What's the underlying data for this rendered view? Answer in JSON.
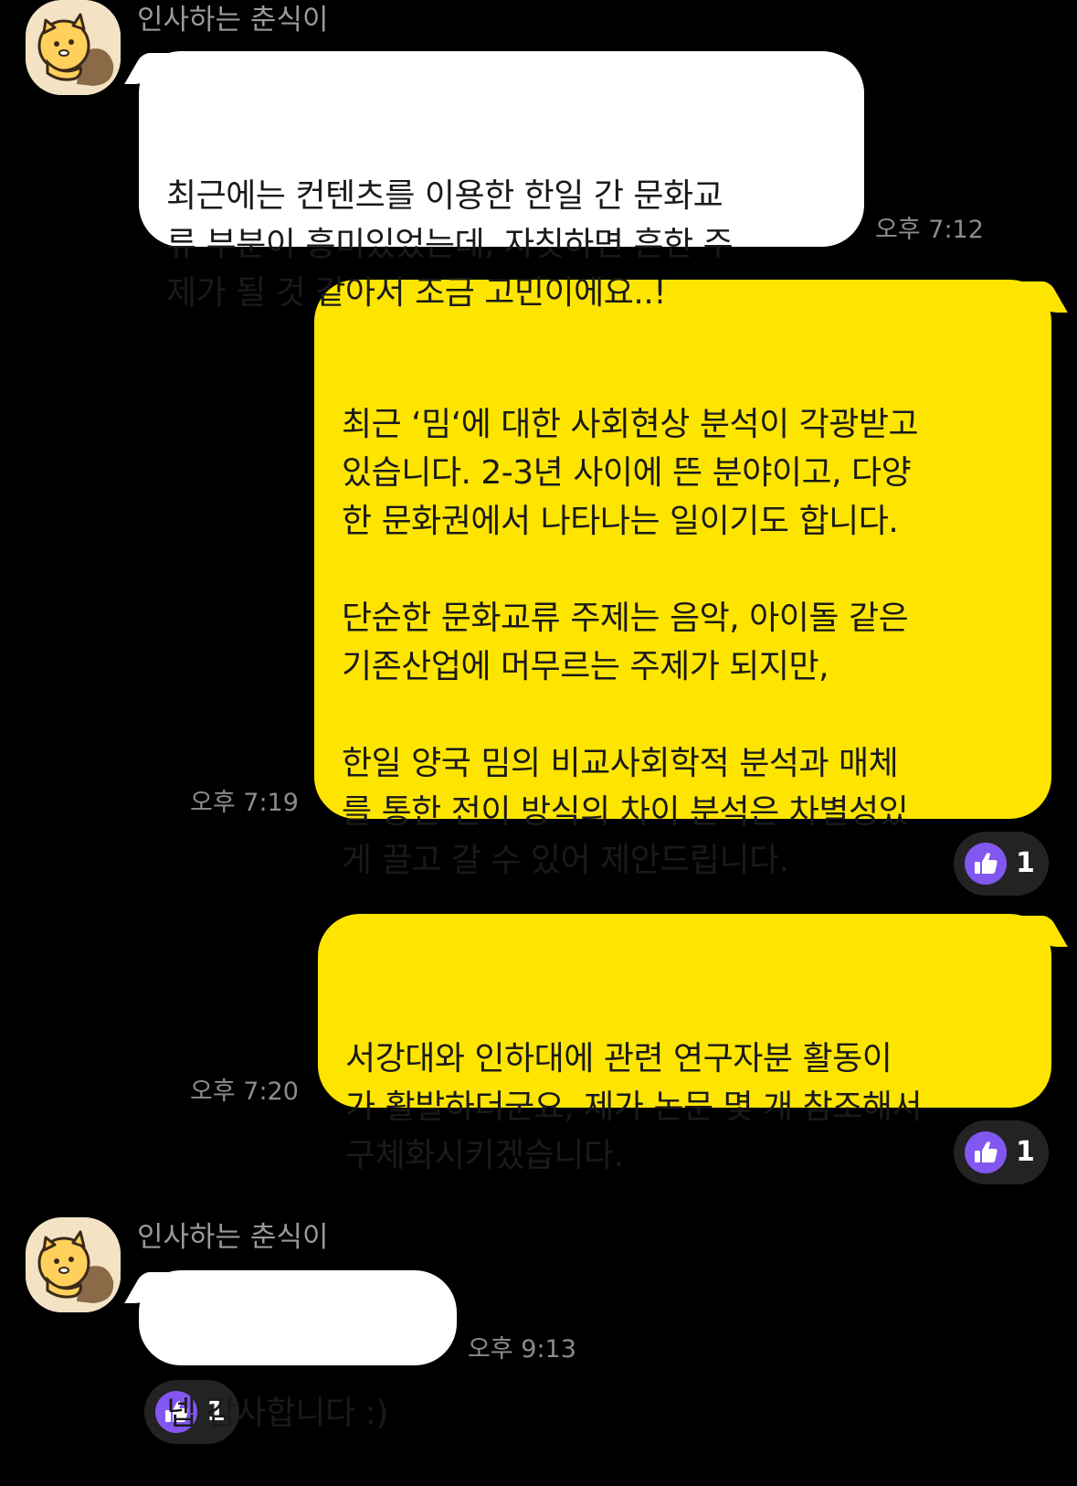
{
  "contact": {
    "name": "인사하는 춘식이"
  },
  "messages": [
    {
      "direction": "in",
      "sender": "인사하는 춘식이",
      "text": "최근에는 컨텐츠를 이용한 한일 간 문화교\n류 부분이 흥미있었는데, 자칫하면 흔한 주\n제가 될 것 같아서 조금 고민이에요..!",
      "time": "오후 7:12"
    },
    {
      "direction": "out",
      "text": "최근 ‘밈‘에 대한 사회현상 분석이 각광받고\n있습니다. 2-3년 사이에 뜬 분야이고, 다양\n한 문화권에서 나타나는 일이기도 합니다.\n\n단순한 문화교류 주제는 음악, 아이돌 같은\n기존산업에 머무르는 주제가 되지만,\n\n한일 양국 밈의 비교사회학적 분석과 매체\n를 통한 전이 방식의 차이 분석은 차별성있\n게 끌고 갈 수 있어 제안드립니다.",
      "time": "오후 7:19",
      "reaction": {
        "icon": "thumbs-up-icon",
        "count": "1"
      }
    },
    {
      "direction": "out",
      "text": "서강대와 인하대에 관련 연구자분 활동이\n가 활발하더군요, 제가 논문 몇 개 참조해서\n구체화시키겠습니다.",
      "time": "오후 7:20",
      "reaction": {
        "icon": "thumbs-up-icon",
        "count": "1"
      }
    },
    {
      "direction": "in",
      "sender": "인사하는 춘식이",
      "text": "넵 감사합니다 :)",
      "time": "오후 9:13",
      "reaction": {
        "icon": "thumbs-up-icon",
        "count": "1"
      }
    }
  ],
  "colors": {
    "background": "#000000",
    "incoming_bubble": "#ffffff",
    "outgoing_bubble": "#fee500",
    "reaction_icon": "#8257f0",
    "reaction_pill": "#232323",
    "meta_text": "#8c8c8c"
  }
}
